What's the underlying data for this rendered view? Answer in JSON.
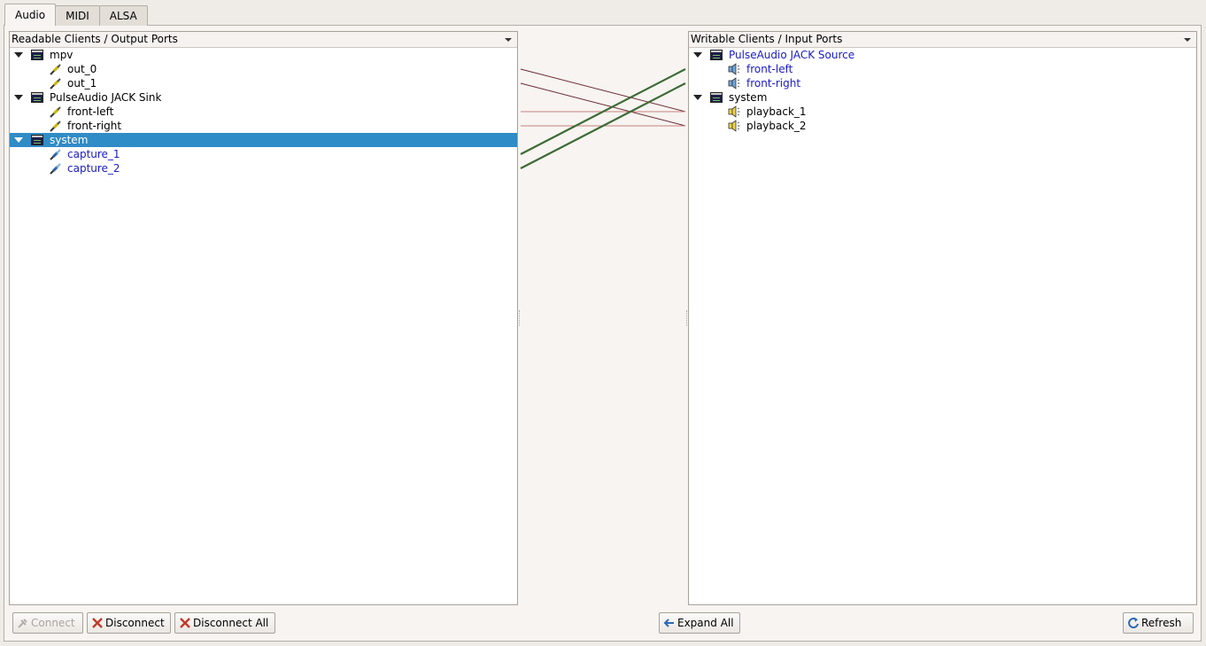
{
  "tabs": [
    {
      "label": "Audio",
      "active": true
    },
    {
      "label": "MIDI",
      "active": false
    },
    {
      "label": "ALSA",
      "active": false
    }
  ],
  "left_panel": {
    "header": "Readable Clients / Output Ports",
    "clients": [
      {
        "name": "mpv",
        "selected": false,
        "ports": [
          "out_0",
          "out_1"
        ],
        "port_color": "#000000"
      },
      {
        "name": "PulseAudio JACK Sink",
        "selected": false,
        "ports": [
          "front-left",
          "front-right"
        ],
        "port_color": "#000000"
      },
      {
        "name": "system",
        "selected": true,
        "ports": [
          "capture_1",
          "capture_2"
        ],
        "port_color": "#1a1ac8"
      }
    ]
  },
  "right_panel": {
    "header": "Writable Clients / Input Ports",
    "clients": [
      {
        "name": "PulseAudio JACK Source",
        "selected": false,
        "name_color": "#1a1ac8",
        "ports": [
          "front-left",
          "front-right"
        ],
        "port_color": "#1a1ac8"
      },
      {
        "name": "system",
        "selected": false,
        "name_color": "#000000",
        "ports": [
          "playback_1",
          "playback_2"
        ],
        "port_color": "#000000"
      }
    ]
  },
  "connections": [
    {
      "from": "mpv:out_0",
      "to": "system:playback_1",
      "color": "#6b2b33"
    },
    {
      "from": "mpv:out_1",
      "to": "system:playback_2",
      "color": "#6b2b33"
    },
    {
      "from": "PulseAudio JACK Sink:front-left",
      "to": "system:playback_1",
      "color": "#c78080"
    },
    {
      "from": "PulseAudio JACK Sink:front-right",
      "to": "system:playback_2",
      "color": "#c78080"
    },
    {
      "from": "system:capture_1",
      "to": "PulseAudio JACK Source:front-left",
      "color": "#3c6b35"
    },
    {
      "from": "system:capture_2",
      "to": "PulseAudio JACK Source:front-right",
      "color": "#3c6b35"
    }
  ],
  "buttons": {
    "connect": "Connect",
    "disconnect": "Disconnect",
    "disconnect_all": "Disconnect All",
    "expand_all": "Expand All",
    "refresh": "Refresh"
  },
  "colors": {
    "selection": "#308cc6",
    "accent_blue": "#1a1ac8"
  }
}
